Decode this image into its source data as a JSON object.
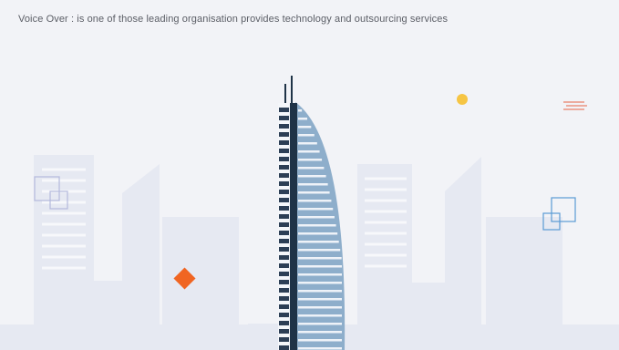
{
  "caption": {
    "text": "Voice Over : is one of those leading organisation provides technology and outsourcing services"
  },
  "scene": {
    "background_color": "#f2f3f7",
    "city_color": "#e6e9f1",
    "tower_color": "#8eaecb",
    "tower_dark_color": "#1f3347",
    "accent_orange": "#f06522",
    "accent_yellow": "#f6c544",
    "accent_blue": "#5b9bd5",
    "accent_lavender": "#b3b9dd",
    "accent_red_lines": "#e8806a",
    "icons": [
      "skyscraper-illustration",
      "diamond-shape",
      "yellow-dot",
      "square-outline",
      "line-dash"
    ]
  }
}
